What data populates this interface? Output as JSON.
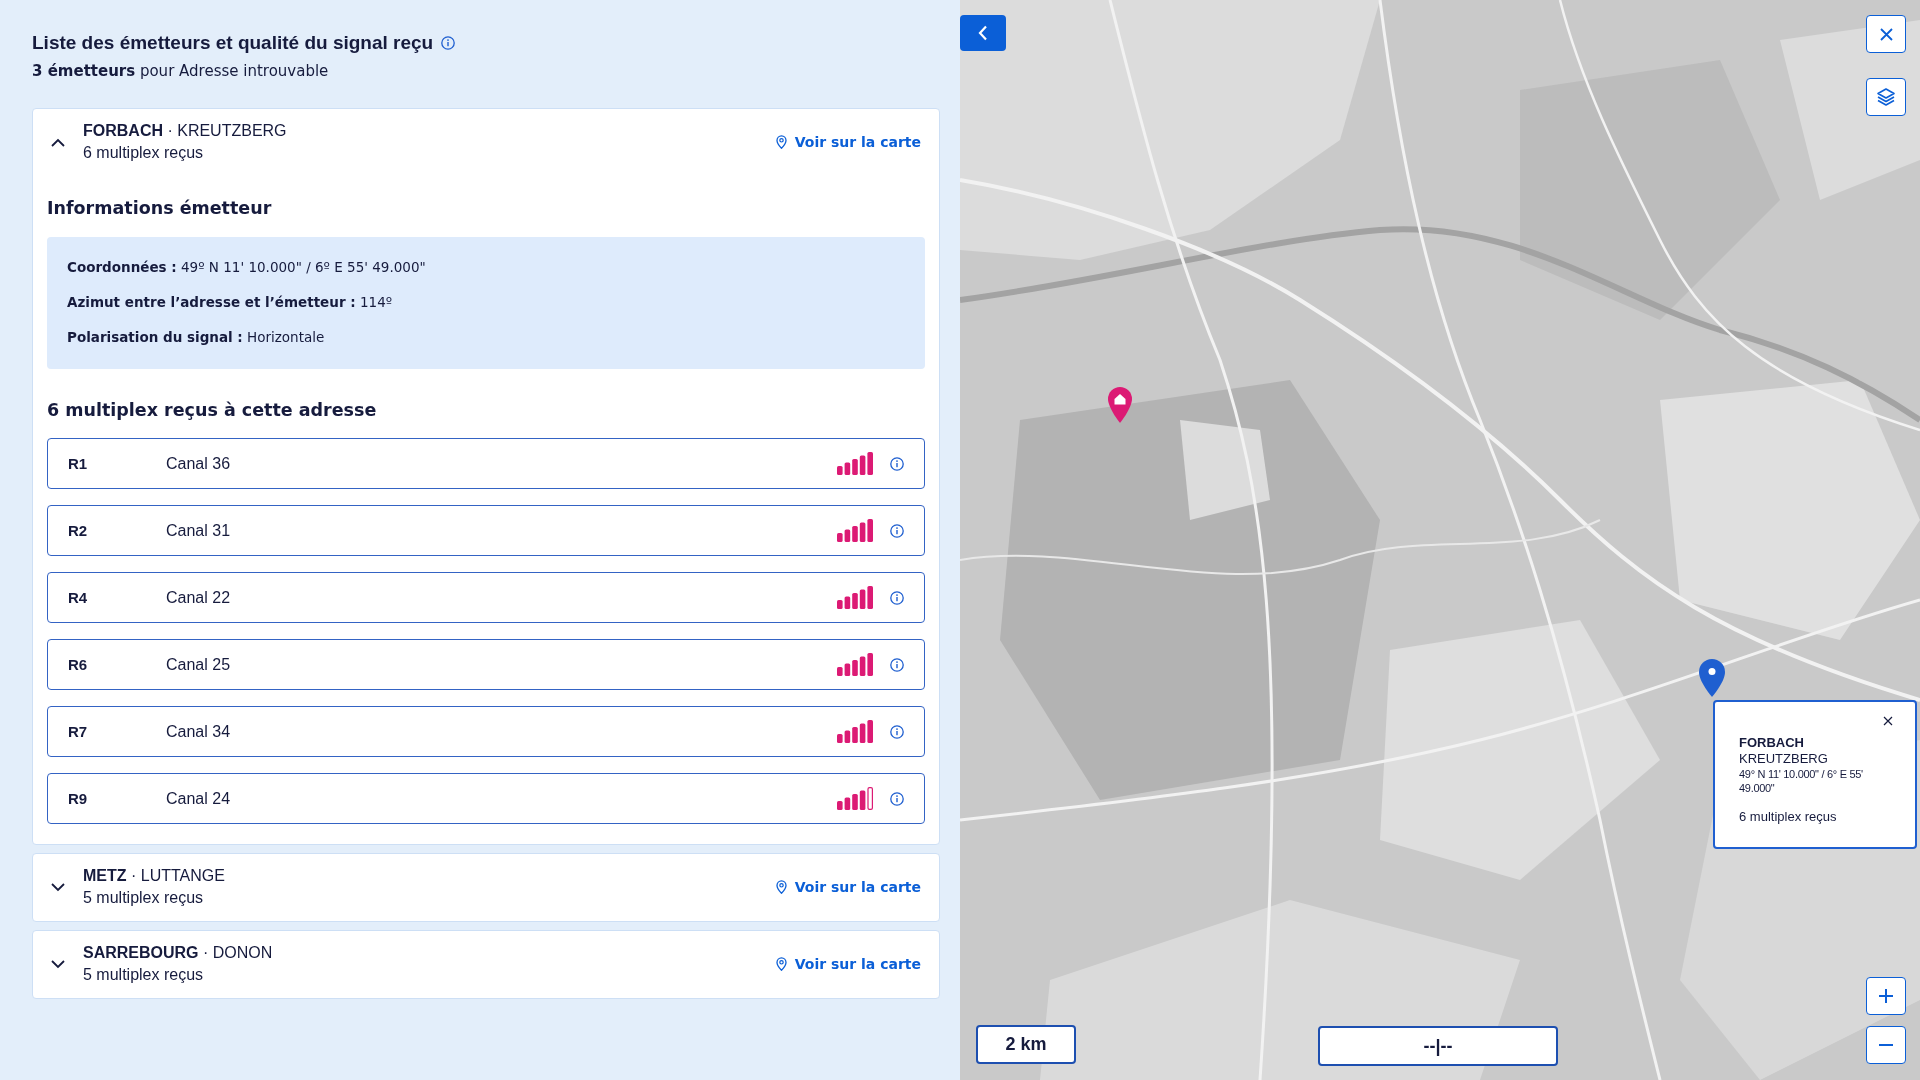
{
  "panel": {
    "title": "Liste des émetteurs et qualité du signal reçu",
    "summary": "**3 émetteurs** pour Adresse introuvable"
  },
  "transmitters": [
    {
      "title": "**FORBACH** · KREUTZBERG",
      "multiplex_count": "6 multiplex reçus",
      "map_link": "Voir sur la carte",
      "expanded": true,
      "details_heading": "Informations émetteur",
      "details": [
        "**Coordonnées :** 49º N 11' 10.000\" / 6º E 55' 49.000\"",
        "**Azimut entre l’adresse et l’émetteur :** 114º",
        "**Polarisation du signal :** Horizontale"
      ],
      "multiplex_heading": "6 multiplex reçus à cette adresse",
      "multiplexes": [
        {
          "name": "R1",
          "channel": "Canal 36",
          "level": 1
        },
        {
          "name": "R2",
          "channel": "Canal 31",
          "level": 1
        },
        {
          "name": "R4",
          "channel": "Canal 22",
          "level": 1
        },
        {
          "name": "R6",
          "channel": "Canal 25",
          "level": 1
        },
        {
          "name": "R7",
          "channel": "Canal 34",
          "level": 1
        },
        {
          "name": "R9",
          "channel": "Canal 24",
          "level": 0.8
        }
      ]
    },
    {
      "title": "**METZ** · LUTTANGE",
      "multiplex_count": "5 multiplex reçus",
      "map_link": "Voir sur la carte",
      "expanded": false
    },
    {
      "title": "**SARREBOURG** · DONON",
      "multiplex_count": "5 multiplex reçus",
      "map_link": "Voir sur la carte",
      "expanded": false
    }
  ],
  "map": {
    "popup": {
      "name": "FORBACH",
      "site": "KREUTZBERG",
      "coordinates": "49° N 11' 10.000\" / 6° E 55' 49.000\"",
      "multiplex_count": "6 multiplex reçus"
    },
    "scale": "2 km",
    "bottom_control": {
      "label": "--|--"
    }
  }
}
